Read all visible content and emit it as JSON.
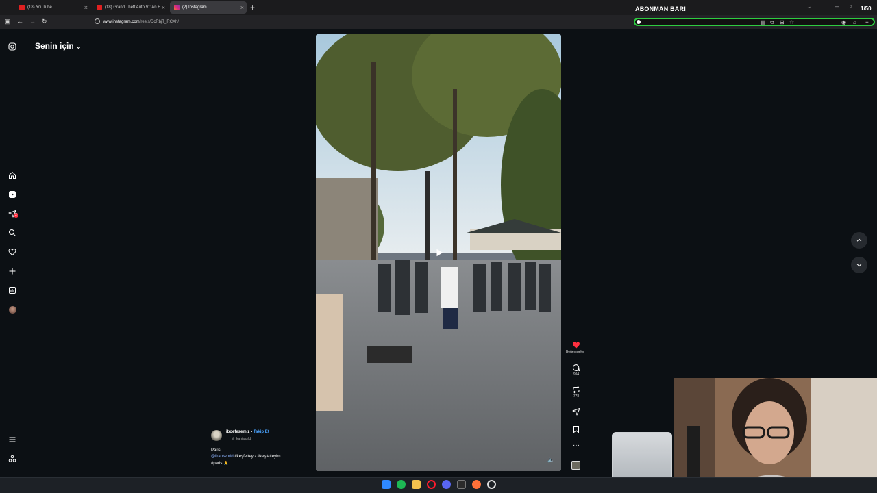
{
  "browser": {
    "tabs": [
      {
        "title": "(18) YouTube",
        "active": false
      },
      {
        "title": "(18) Grand Theft Auto VI: An E...",
        "active": false
      },
      {
        "title": "(2) Instagram",
        "active": true
      }
    ],
    "url_domain": "www.instagram.com",
    "url_path": "/reels/DcRbjT_RCXh/",
    "panel_title": "ABONMAN BARI",
    "page_counter": "1/50"
  },
  "instagram": {
    "feed_title": "Senin için",
    "notification_badge": "2",
    "rail_icons": [
      "home-icon",
      "reels-icon",
      "send-icon",
      "search-icon",
      "heart-icon",
      "plus-icon",
      "insights-icon",
      "profile-avatar"
    ],
    "bottom_rail_icons": [
      "menu-icon",
      "apps-icon"
    ]
  },
  "post": {
    "username": "iboefesemiz",
    "follow_label": "Takip Et",
    "sub_label": "ikaniworld",
    "caption_line1": "Paris...",
    "caption_mention": "@ikaniworld",
    "caption_tags1": "#keşfetteyiz #keşfetteyim",
    "caption_tags2": "#paris 🙏",
    "actions": {
      "likes_label": "Beğenmeler",
      "comments": "994",
      "reposts": "778"
    }
  },
  "colors": {
    "accent_green": "#2ecc40",
    "like_red": "#ff3040",
    "follow_blue": "#4aa3ff"
  }
}
